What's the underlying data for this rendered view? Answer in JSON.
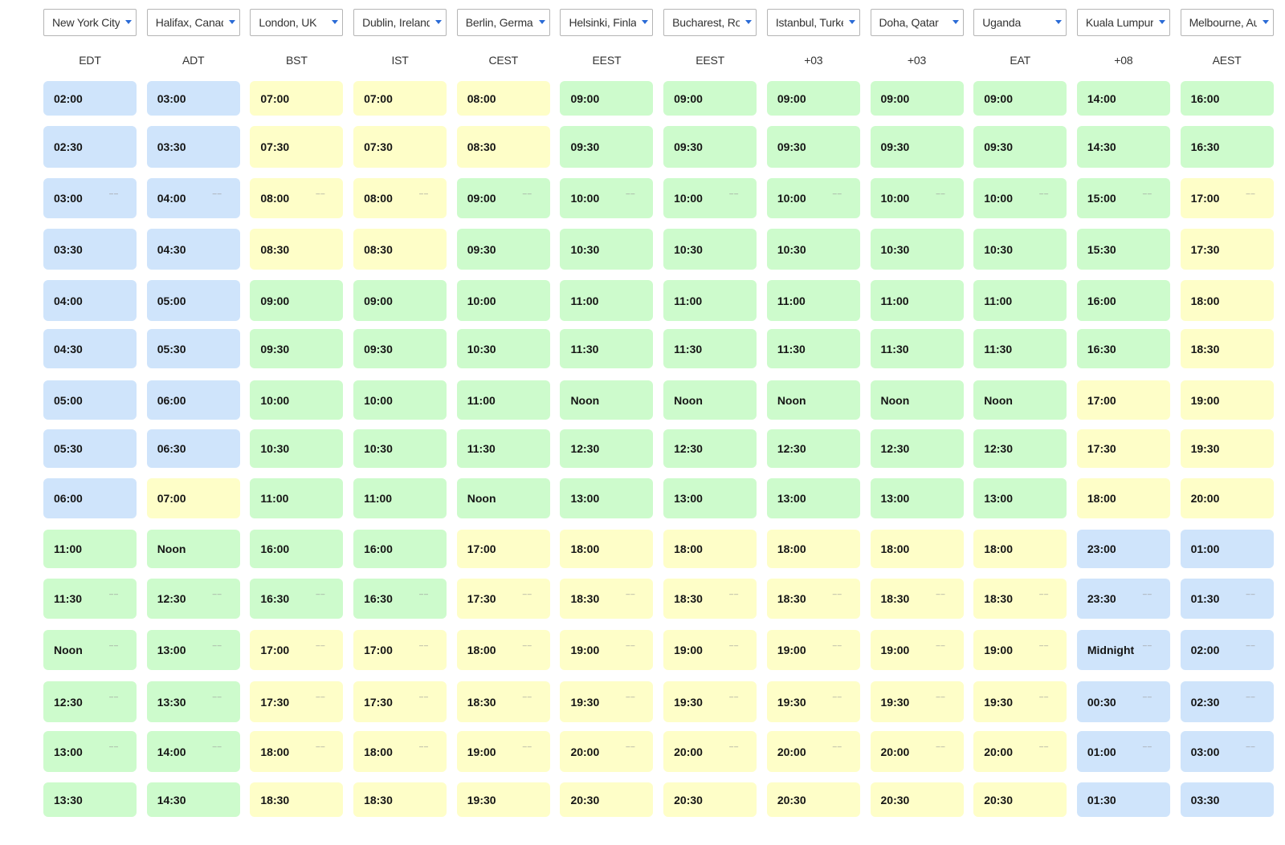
{
  "cities": [
    {
      "label": "New York City",
      "tz": "EDT"
    },
    {
      "label": "Halifax, Canada",
      "tz": "ADT"
    },
    {
      "label": "London, UK",
      "tz": "BST"
    },
    {
      "label": "Dublin, Ireland",
      "tz": "IST"
    },
    {
      "label": "Berlin, Germany",
      "tz": "CEST"
    },
    {
      "label": "Helsinki, Finland",
      "tz": "EEST"
    },
    {
      "label": "Bucharest, Romania",
      "tz": "EEST"
    },
    {
      "label": "Istanbul, Turkey",
      "tz": "+03"
    },
    {
      "label": "Doha, Qatar",
      "tz": "+03"
    },
    {
      "label": "Uganda",
      "tz": "EAT"
    },
    {
      "label": "Kuala Lumpur",
      "tz": "+08"
    },
    {
      "label": "Melbourne, Australia",
      "tz": "AEST"
    }
  ],
  "colors": {
    "blue": "#cfe4fb",
    "green": "#cdfbcc",
    "yellow": "#fefec8",
    "caret": "#2b6bd6"
  },
  "rows": [
    {
      "times": [
        "02:00",
        "03:00",
        "07:00",
        "07:00",
        "08:00",
        "09:00",
        "09:00",
        "09:00",
        "09:00",
        "09:00",
        "14:00",
        "16:00"
      ],
      "colors": [
        "blue",
        "blue",
        "yellow",
        "yellow",
        "yellow",
        "green",
        "green",
        "green",
        "green",
        "green",
        "green",
        "green"
      ]
    },
    {
      "times": [
        "02:30",
        "03:30",
        "07:30",
        "07:30",
        "08:30",
        "09:30",
        "09:30",
        "09:30",
        "09:30",
        "09:30",
        "14:30",
        "16:30"
      ],
      "colors": [
        "blue",
        "blue",
        "yellow",
        "yellow",
        "yellow",
        "green",
        "green",
        "green",
        "green",
        "green",
        "green",
        "green"
      ]
    },
    {
      "times": [
        "03:00",
        "04:00",
        "08:00",
        "08:00",
        "09:00",
        "10:00",
        "10:00",
        "10:00",
        "10:00",
        "10:00",
        "15:00",
        "17:00"
      ],
      "colors": [
        "blue",
        "blue",
        "yellow",
        "yellow",
        "green",
        "green",
        "green",
        "green",
        "green",
        "green",
        "green",
        "yellow"
      ]
    },
    {
      "times": [
        "03:30",
        "04:30",
        "08:30",
        "08:30",
        "09:30",
        "10:30",
        "10:30",
        "10:30",
        "10:30",
        "10:30",
        "15:30",
        "17:30"
      ],
      "colors": [
        "blue",
        "blue",
        "yellow",
        "yellow",
        "green",
        "green",
        "green",
        "green",
        "green",
        "green",
        "green",
        "yellow"
      ]
    },
    {
      "times": [
        "04:00",
        "05:00",
        "09:00",
        "09:00",
        "10:00",
        "11:00",
        "11:00",
        "11:00",
        "11:00",
        "11:00",
        "16:00",
        "18:00"
      ],
      "colors": [
        "blue",
        "blue",
        "green",
        "green",
        "green",
        "green",
        "green",
        "green",
        "green",
        "green",
        "green",
        "yellow"
      ]
    },
    {
      "times": [
        "04:30",
        "05:30",
        "09:30",
        "09:30",
        "10:30",
        "11:30",
        "11:30",
        "11:30",
        "11:30",
        "11:30",
        "16:30",
        "18:30"
      ],
      "colors": [
        "blue",
        "blue",
        "green",
        "green",
        "green",
        "green",
        "green",
        "green",
        "green",
        "green",
        "green",
        "yellow"
      ]
    },
    {
      "times": [
        "05:00",
        "06:00",
        "10:00",
        "10:00",
        "11:00",
        "Noon",
        "Noon",
        "Noon",
        "Noon",
        "Noon",
        "17:00",
        "19:00"
      ],
      "colors": [
        "blue",
        "blue",
        "green",
        "green",
        "green",
        "green",
        "green",
        "green",
        "green",
        "green",
        "yellow",
        "yellow"
      ]
    },
    {
      "times": [
        "05:30",
        "06:30",
        "10:30",
        "10:30",
        "11:30",
        "12:30",
        "12:30",
        "12:30",
        "12:30",
        "12:30",
        "17:30",
        "19:30"
      ],
      "colors": [
        "blue",
        "blue",
        "green",
        "green",
        "green",
        "green",
        "green",
        "green",
        "green",
        "green",
        "yellow",
        "yellow"
      ]
    },
    {
      "times": [
        "06:00",
        "07:00",
        "11:00",
        "11:00",
        "Noon",
        "13:00",
        "13:00",
        "13:00",
        "13:00",
        "13:00",
        "18:00",
        "20:00"
      ],
      "colors": [
        "blue",
        "yellow",
        "green",
        "green",
        "green",
        "green",
        "green",
        "green",
        "green",
        "green",
        "yellow",
        "yellow"
      ]
    },
    {
      "times": [
        "11:00",
        "Noon",
        "16:00",
        "16:00",
        "17:00",
        "18:00",
        "18:00",
        "18:00",
        "18:00",
        "18:00",
        "23:00",
        "01:00"
      ],
      "colors": [
        "green",
        "green",
        "green",
        "green",
        "yellow",
        "yellow",
        "yellow",
        "yellow",
        "yellow",
        "yellow",
        "blue",
        "blue"
      ]
    },
    {
      "times": [
        "11:30",
        "12:30",
        "16:30",
        "16:30",
        "17:30",
        "18:30",
        "18:30",
        "18:30",
        "18:30",
        "18:30",
        "23:30",
        "01:30"
      ],
      "colors": [
        "green",
        "green",
        "green",
        "green",
        "yellow",
        "yellow",
        "yellow",
        "yellow",
        "yellow",
        "yellow",
        "blue",
        "blue"
      ]
    },
    {
      "times": [
        "Noon",
        "13:00",
        "17:00",
        "17:00",
        "18:00",
        "19:00",
        "19:00",
        "19:00",
        "19:00",
        "19:00",
        "Midnight",
        "02:00"
      ],
      "colors": [
        "green",
        "green",
        "yellow",
        "yellow",
        "yellow",
        "yellow",
        "yellow",
        "yellow",
        "yellow",
        "yellow",
        "blue",
        "blue"
      ]
    },
    {
      "times": [
        "12:30",
        "13:30",
        "17:30",
        "17:30",
        "18:30",
        "19:30",
        "19:30",
        "19:30",
        "19:30",
        "19:30",
        "00:30",
        "02:30"
      ],
      "colors": [
        "green",
        "green",
        "yellow",
        "yellow",
        "yellow",
        "yellow",
        "yellow",
        "yellow",
        "yellow",
        "yellow",
        "blue",
        "blue"
      ]
    },
    {
      "times": [
        "13:00",
        "14:00",
        "18:00",
        "18:00",
        "19:00",
        "20:00",
        "20:00",
        "20:00",
        "20:00",
        "20:00",
        "01:00",
        "03:00"
      ],
      "colors": [
        "green",
        "green",
        "yellow",
        "yellow",
        "yellow",
        "yellow",
        "yellow",
        "yellow",
        "yellow",
        "yellow",
        "blue",
        "blue"
      ]
    },
    {
      "times": [
        "13:30",
        "14:30",
        "18:30",
        "18:30",
        "19:30",
        "20:30",
        "20:30",
        "20:30",
        "20:30",
        "20:30",
        "01:30",
        "03:30"
      ],
      "colors": [
        "green",
        "green",
        "yellow",
        "yellow",
        "yellow",
        "yellow",
        "yellow",
        "yellow",
        "yellow",
        "yellow",
        "blue",
        "blue"
      ]
    }
  ]
}
